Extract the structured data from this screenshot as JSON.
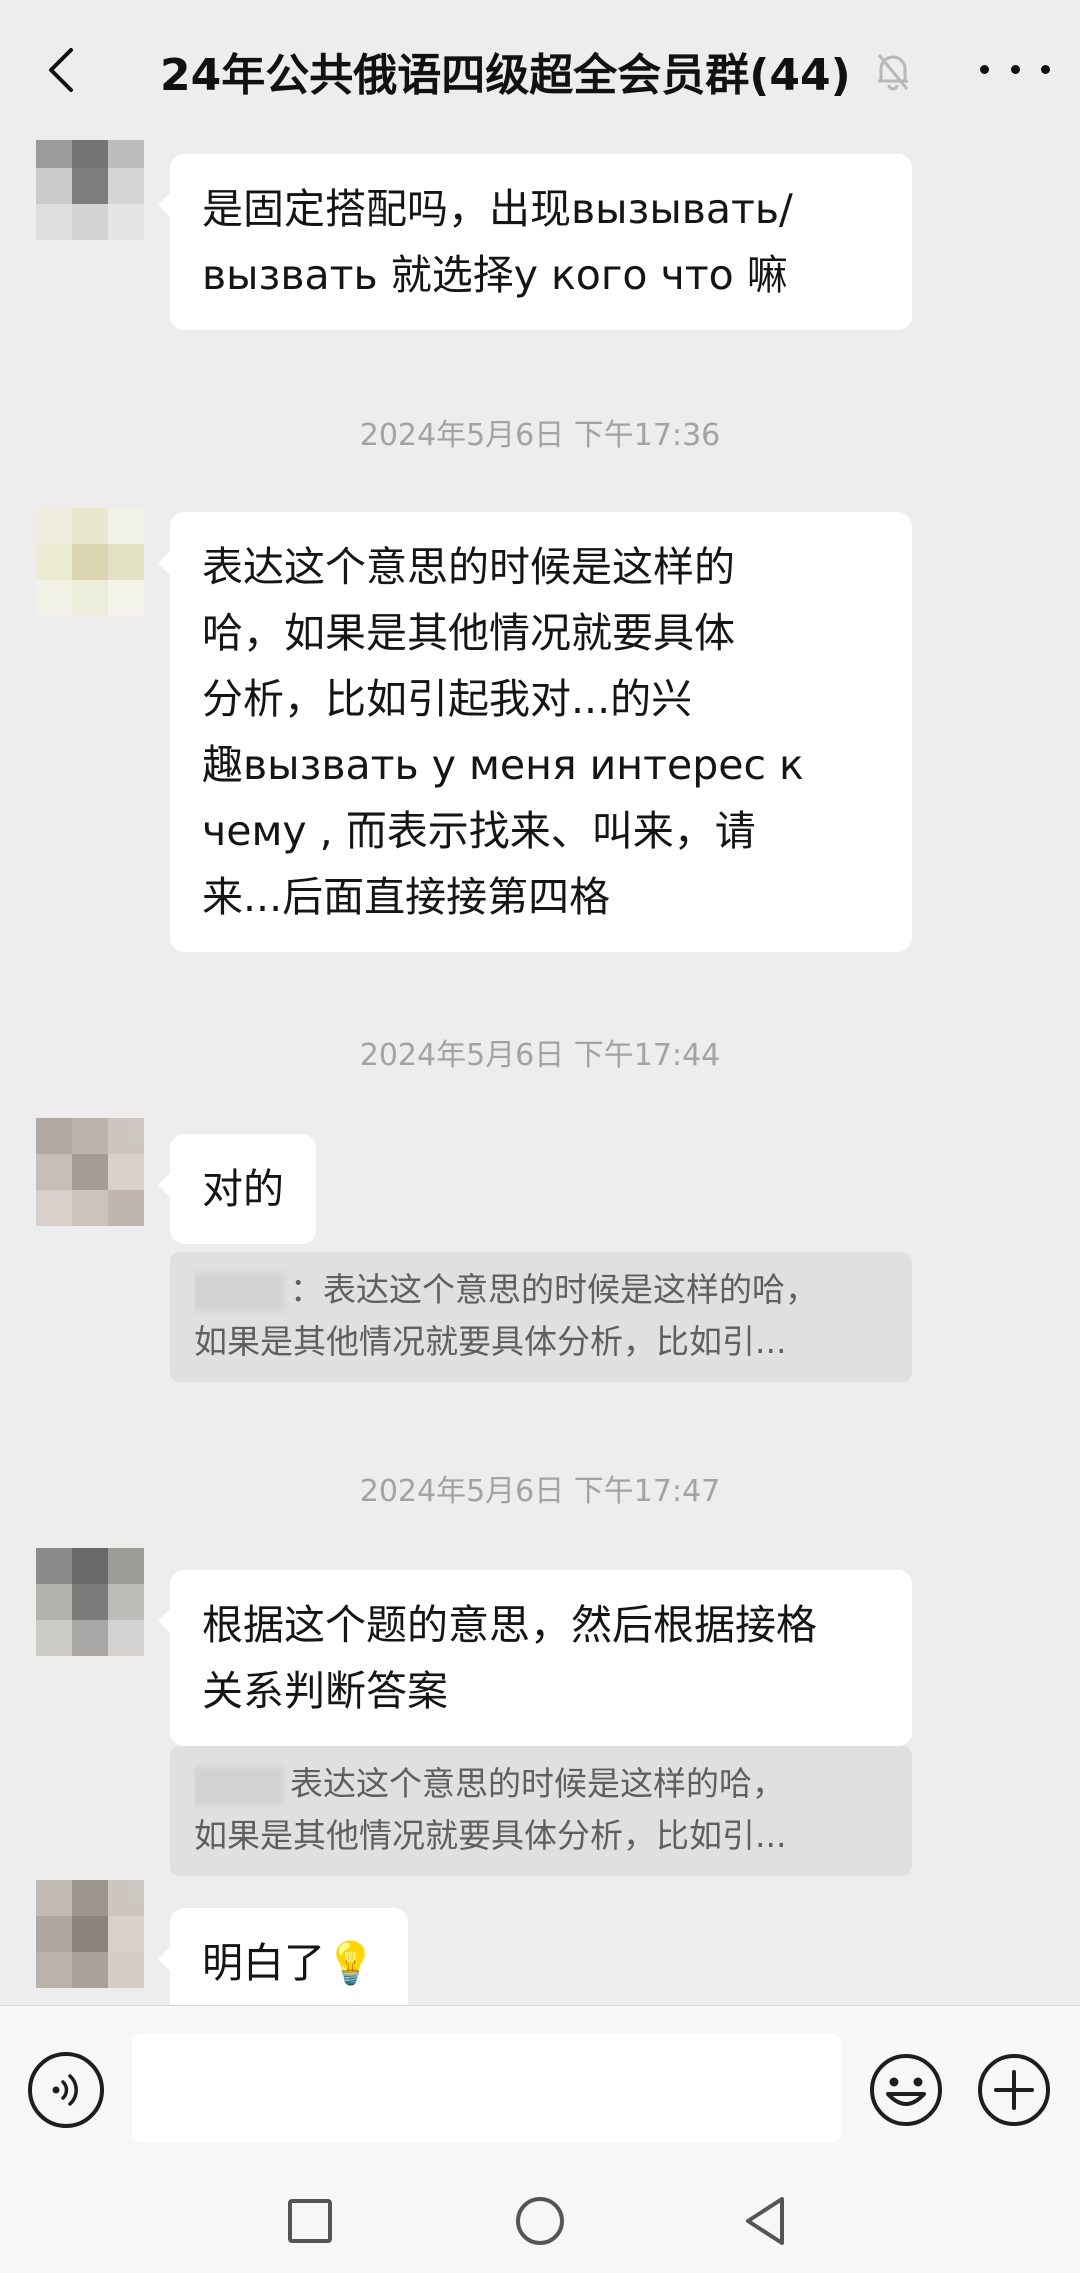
{
  "header": {
    "title": "24年公共俄语四级超全会员群(44)",
    "back_icon": "chevron-left-icon",
    "mute_icon": "bell-muted-icon",
    "more_icon": "more-dots-icon"
  },
  "messages": [
    {
      "text_lines": [
        "是固定搭配吗，出现вызывать/",
        "вызвать 就选择у кого что 嘛"
      ]
    },
    {
      "text_lines": [
        "表达这个意思的时候是这样的",
        "哈，如果是其他情况就要具体",
        "分析，比如引起我对...的兴",
        "趣вызвать у меня интерес к",
        "чему , 而表示找来、叫来，请",
        "来...后面直接接第四格"
      ]
    },
    {
      "text_lines": [
        "对的"
      ]
    },
    {
      "text_lines": [
        "根据这个题的意思，然后根据接格",
        "关系判断答案"
      ]
    },
    {
      "text_lines": [
        "明白了💡"
      ]
    }
  ],
  "timestamps": [
    "2024年5月6日 下午17:36",
    "2024年5月6日 下午17:44",
    "2024年5月6日 下午17:47"
  ],
  "quotes": [
    {
      "line1": "：表达这个意思的时候是这样的哈，",
      "line2": "如果是其他情况就要具体分析，比如引..."
    },
    {
      "line1": "表达这个意思的时候是这样的哈，",
      "line2": "如果是其他情况就要具体分析，比如引..."
    }
  ],
  "input_bar": {
    "voice_icon": "voice-icon",
    "text_value": "",
    "emoji_icon": "emoji-icon",
    "plus_icon": "plus-icon"
  },
  "nav_bar": {
    "recents_icon": "square-recents-icon",
    "home_icon": "circle-home-icon",
    "back_icon": "triangle-back-icon"
  },
  "colors": {
    "background": "#ededed",
    "bubble": "#ffffff",
    "quote_bg": "#e0e0e0",
    "timestamp": "#a3a3a3"
  }
}
